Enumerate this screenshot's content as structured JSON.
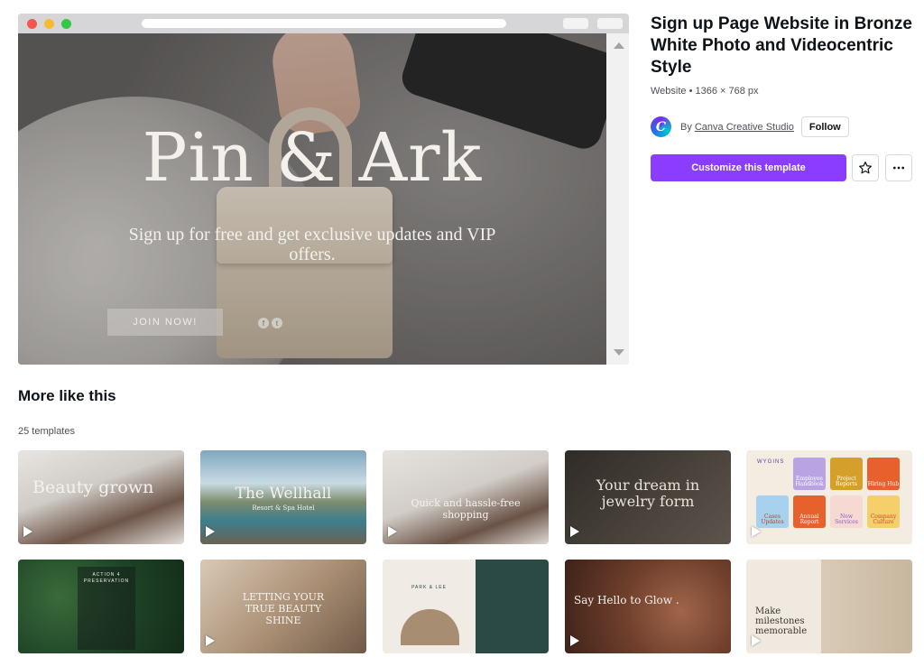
{
  "preview": {
    "hero_title": "Pin & Ark",
    "hero_subtitle": "Sign up for free and get exclusive updates and VIP offers.",
    "join_button": "JOIN NOW!",
    "social_icons": [
      "facebook-icon",
      "twitter-icon"
    ]
  },
  "template": {
    "title": "Sign up Page Website in Bronze White Photo and Videocentric Style",
    "meta": "Website • 1366 × 768 px",
    "by_label": "By",
    "creator": "Canva Creative Studio",
    "follow_label": "Follow",
    "customize_label": "Customize this template",
    "brand_color": "#8b3dff"
  },
  "more": {
    "title": "More like this",
    "count": "25 templates",
    "thumbnails": [
      {
        "text": "Beauty grown"
      },
      {
        "text": "The Wellhall",
        "sub": "Resort & Spa Hotel"
      },
      {
        "text": "Quick and hassle-free shopping"
      },
      {
        "text": "Your dream in jewelry form"
      },
      {
        "text": "WYGINS",
        "tiles": [
          "Employee Handbook",
          "Project Reports",
          "Hiring Hub",
          "Cases Updates",
          "Annual Report",
          "New Services",
          "Company Culture"
        ]
      },
      {
        "text": "ACTION 4 PRESERVATION"
      },
      {
        "text": "LETTING YOUR TRUE BEAUTY SHINE"
      },
      {
        "text": "PARK & LEE"
      },
      {
        "text": "Say Hello to Glow ."
      },
      {
        "text": "Make milestones memorable"
      }
    ]
  }
}
